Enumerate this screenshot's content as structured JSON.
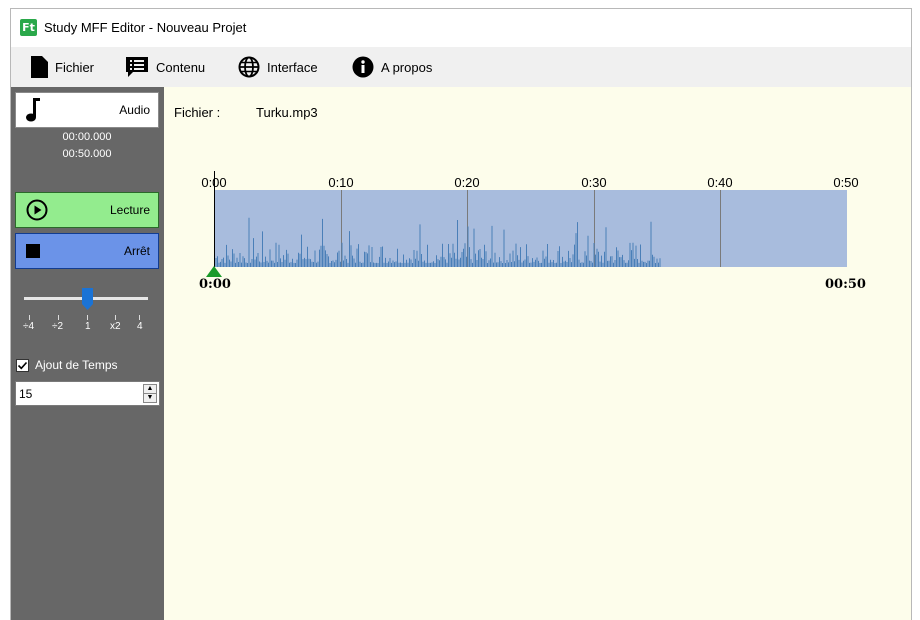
{
  "window": {
    "title": "Study MFF Editor - Nouveau Projet",
    "icon_text": "Ft"
  },
  "menu": [
    {
      "label": "Fichier",
      "icon": "file-icon"
    },
    {
      "label": "Contenu",
      "icon": "list-icon"
    },
    {
      "label": "Interface",
      "icon": "globe-icon"
    },
    {
      "label": "A propos",
      "icon": "info-icon"
    }
  ],
  "sidebar": {
    "audio_label": "Audio",
    "current_time": "00:00.000",
    "total_time": "00:50.000",
    "play_label": "Lecture",
    "stop_label": "Arrêt",
    "speed_ticks": [
      "÷4",
      "÷2",
      "1",
      "x2",
      "4"
    ],
    "speed_selected_index": 2,
    "add_time_label": "Ajout de Temps",
    "add_time_checked": true,
    "add_time_value": "15",
    "colors": {
      "sidebar_bg": "#676767",
      "play": "#93ec8e",
      "stop": "#6b93e8",
      "slider_thumb": "#1a73d6"
    }
  },
  "main": {
    "file_label": "Fichier :",
    "file_name": "Turku.mp3",
    "ruler": [
      "0:00",
      "0:10",
      "0:20",
      "0:30",
      "0:40",
      "0:50"
    ],
    "start_time": "0:00",
    "end_time": "00:50",
    "duration_seconds": 50,
    "audio_end_seconds": 35,
    "colors": {
      "main_bg": "#fdfdeb",
      "waveform_bg": "#a8bcdd",
      "waveform": "#4a7fb8",
      "marker": "#1a9a2a"
    }
  }
}
